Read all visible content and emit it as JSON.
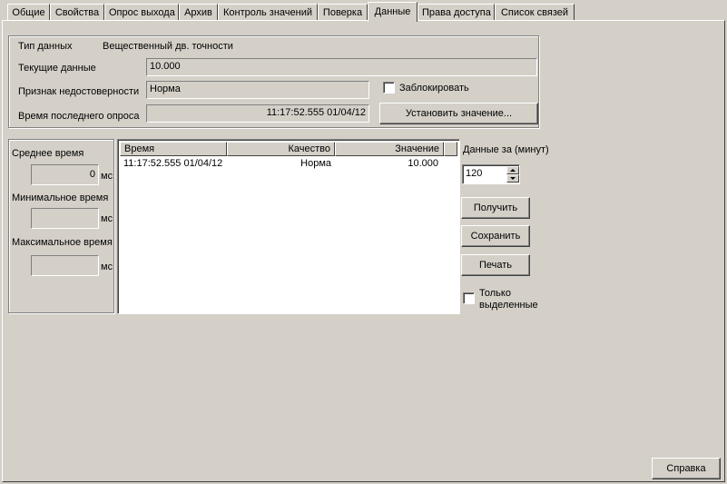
{
  "tabs": [
    {
      "label": "Общие"
    },
    {
      "label": "Свойства"
    },
    {
      "label": "Опрос выхода"
    },
    {
      "label": "Архив"
    },
    {
      "label": "Контроль значений"
    },
    {
      "label": "Поверка"
    },
    {
      "label": "Данные",
      "active": true
    },
    {
      "label": "Права доступа"
    },
    {
      "label": "Список связей"
    }
  ],
  "info": {
    "data_type_label": "Тип данных",
    "data_type_value": "Вещественный дв. точности",
    "current_data_label": "Текущие данные",
    "current_data_value": "10.000",
    "invalid_flag_label": "Признак недостоверности",
    "invalid_flag_value": "Норма",
    "lock_label": "Заблокировать",
    "lock_checked": false,
    "last_poll_label": "Время последнего опроса",
    "last_poll_value": "11:17:52.555 01/04/12",
    "set_value_button": "Установить значение..."
  },
  "stats": {
    "avg_label": "Среднее время",
    "avg_value": "0",
    "min_label": "Минимальное время",
    "min_value": "",
    "max_label": "Максимальное время",
    "max_value": "",
    "unit": "мс"
  },
  "table": {
    "columns": [
      "Время",
      "Качество",
      "Значение"
    ],
    "rows": [
      {
        "time": "11:17:52.555 01/04/12",
        "quality": "Норма",
        "value": "10.000"
      }
    ]
  },
  "controls": {
    "period_label": "Данные за (минут)",
    "period_value": "120",
    "get_button": "Получить",
    "save_button": "Сохранить",
    "print_button": "Печать",
    "selected_only_label_1": "Только",
    "selected_only_label_2": "выделенные",
    "selected_only_checked": false
  },
  "footer": {
    "help_button": "Справка"
  }
}
